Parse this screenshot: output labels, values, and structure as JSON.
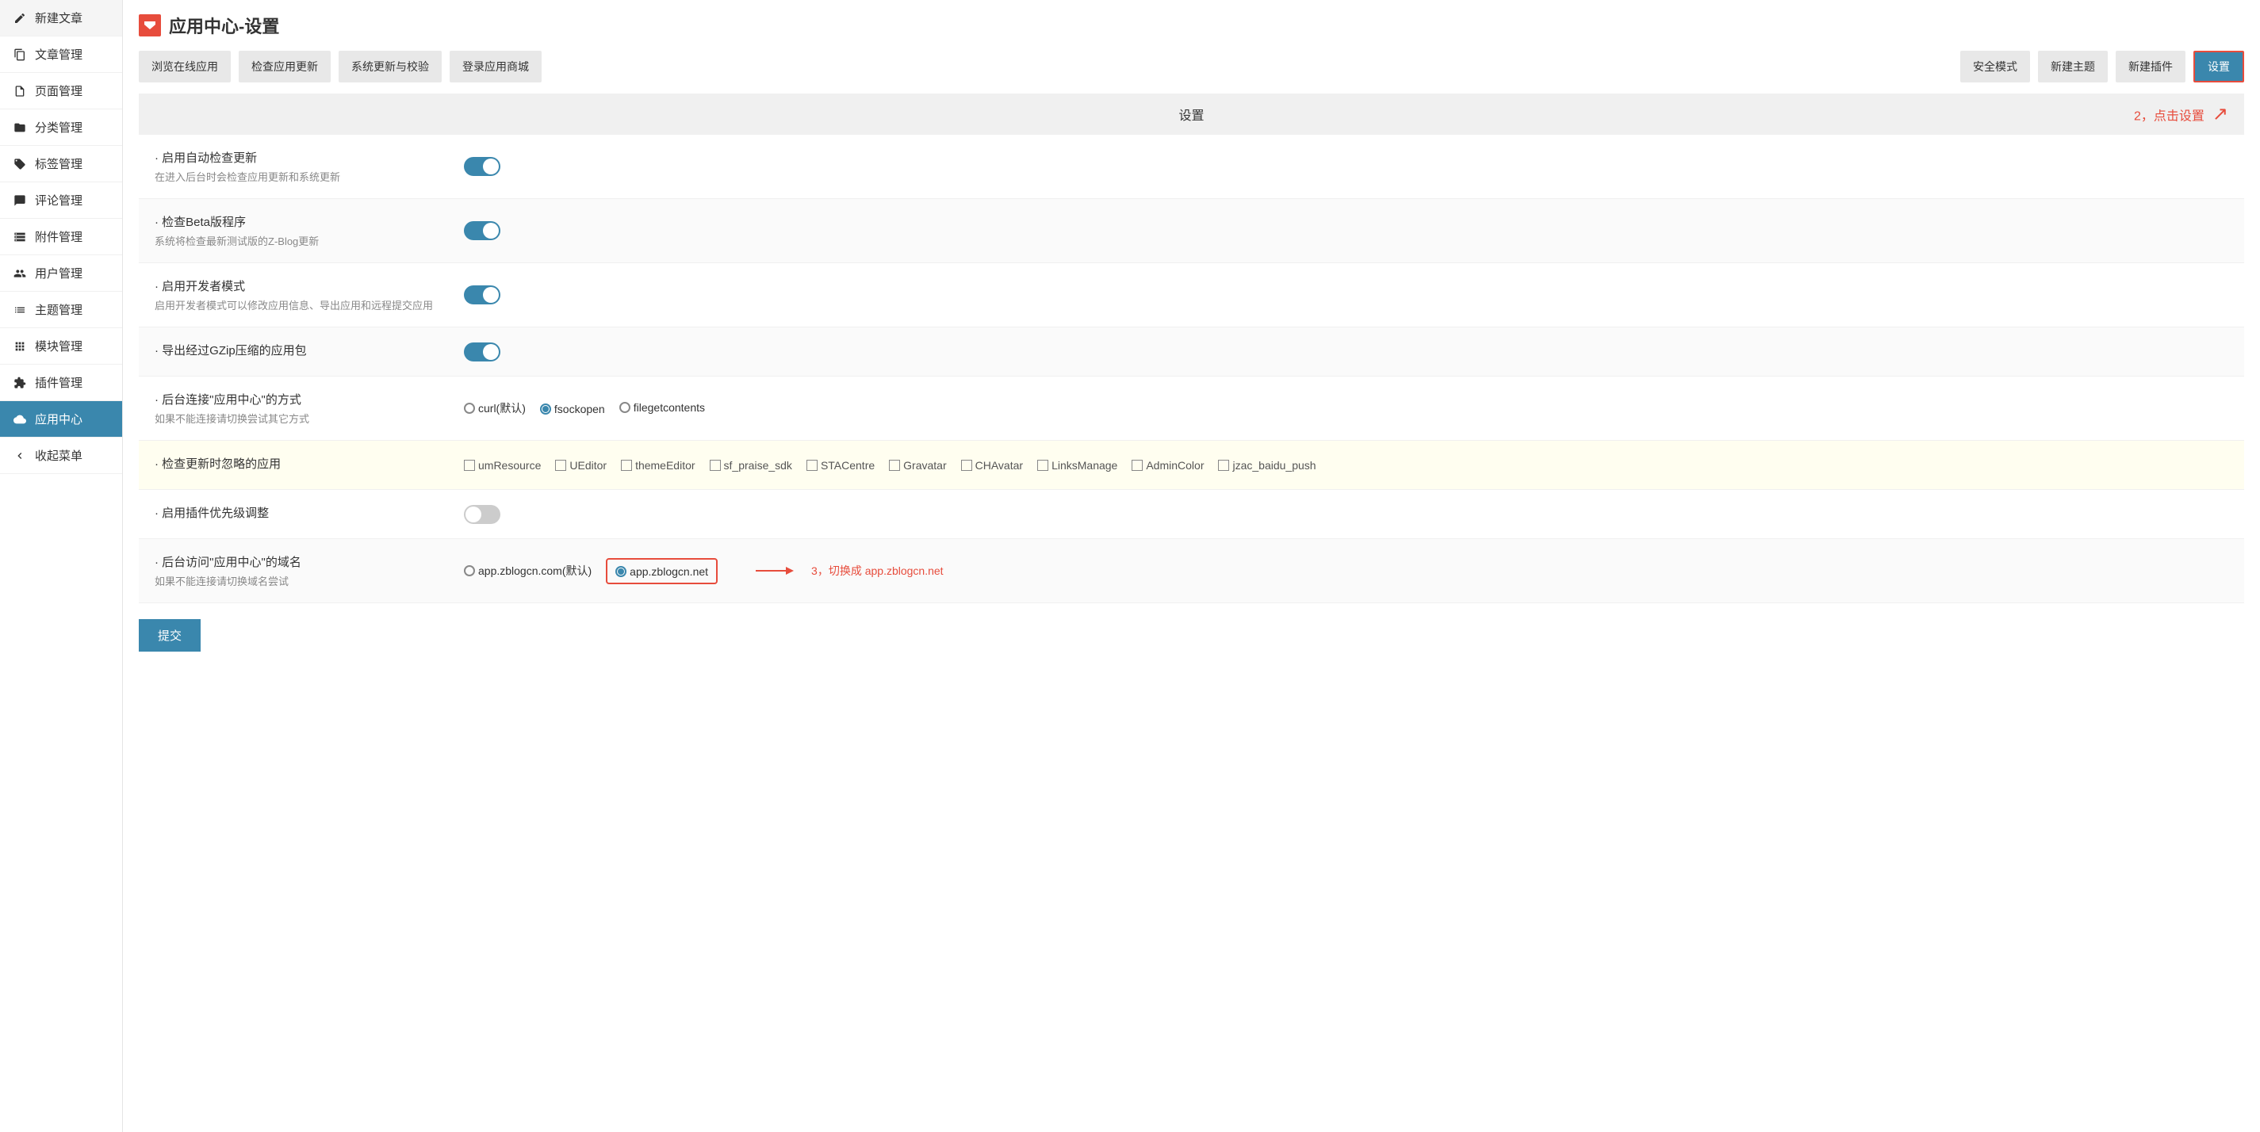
{
  "sidebar": {
    "items": [
      {
        "label": "新建文章",
        "icon": "edit"
      },
      {
        "label": "文章管理",
        "icon": "copy"
      },
      {
        "label": "页面管理",
        "icon": "page"
      },
      {
        "label": "分类管理",
        "icon": "folder"
      },
      {
        "label": "标签管理",
        "icon": "tag"
      },
      {
        "label": "评论管理",
        "icon": "comment"
      },
      {
        "label": "附件管理",
        "icon": "attach"
      },
      {
        "label": "用户管理",
        "icon": "users"
      },
      {
        "label": "主题管理",
        "icon": "theme"
      },
      {
        "label": "模块管理",
        "icon": "modules"
      },
      {
        "label": "插件管理",
        "icon": "plugin"
      },
      {
        "label": "应用中心",
        "icon": "cloud",
        "active": true
      },
      {
        "label": "收起菜单",
        "icon": "collapse"
      }
    ]
  },
  "page": {
    "title": "应用中心-设置"
  },
  "toolbar": {
    "left": [
      {
        "label": "浏览在线应用"
      },
      {
        "label": "检查应用更新"
      },
      {
        "label": "系统更新与校验"
      },
      {
        "label": "登录应用商城"
      }
    ],
    "right": [
      {
        "label": "安全模式"
      },
      {
        "label": "新建主题"
      },
      {
        "label": "新建插件"
      },
      {
        "label": "设置",
        "primary": true,
        "highlighted": true
      }
    ]
  },
  "settings_header": "设置",
  "annotations": {
    "step2": "2，点击设置",
    "step3": "3，切换成 app.zblogcn.net"
  },
  "settings": [
    {
      "title": "启用自动检查更新",
      "desc": "在进入后台时会检查应用更新和系统更新",
      "type": "toggle",
      "value": true
    },
    {
      "title": "检查Beta版程序",
      "desc": "系统将检查最新测试版的Z-Blog更新",
      "type": "toggle",
      "value": true,
      "alt": true
    },
    {
      "title": "启用开发者模式",
      "desc": "启用开发者模式可以修改应用信息、导出应用和远程提交应用",
      "type": "toggle",
      "value": true
    },
    {
      "title": "导出经过GZip压缩的应用包",
      "desc": "",
      "type": "toggle",
      "value": true,
      "alt": true
    },
    {
      "title": "后台连接\"应用中心\"的方式",
      "desc": "如果不能连接请切换尝试其它方式",
      "type": "radio",
      "options": [
        {
          "label": "curl(默认)",
          "checked": false
        },
        {
          "label": "fsockopen",
          "checked": true
        },
        {
          "label": "filegetcontents",
          "checked": false
        }
      ]
    },
    {
      "title": "检查更新时忽略的应用",
      "desc": "",
      "type": "checkboxes",
      "highlight": true,
      "options": [
        {
          "label": "umResource"
        },
        {
          "label": "UEditor"
        },
        {
          "label": "themeEditor"
        },
        {
          "label": "sf_praise_sdk"
        },
        {
          "label": "STACentre"
        },
        {
          "label": "Gravatar"
        },
        {
          "label": "CHAvatar"
        },
        {
          "label": "LinksManage"
        },
        {
          "label": "AdminColor"
        },
        {
          "label": "jzac_baidu_push"
        }
      ]
    },
    {
      "title": "启用插件优先级调整",
      "desc": "",
      "type": "toggle",
      "value": false
    },
    {
      "title": "后台访问\"应用中心\"的域名",
      "desc": "如果不能连接请切换域名尝试",
      "type": "radio",
      "alt": true,
      "annotation3": true,
      "options": [
        {
          "label": "app.zblogcn.com(默认)",
          "checked": false
        },
        {
          "label": "app.zblogcn.net",
          "checked": true,
          "highlighted": true
        }
      ]
    }
  ],
  "submit_label": "提交"
}
